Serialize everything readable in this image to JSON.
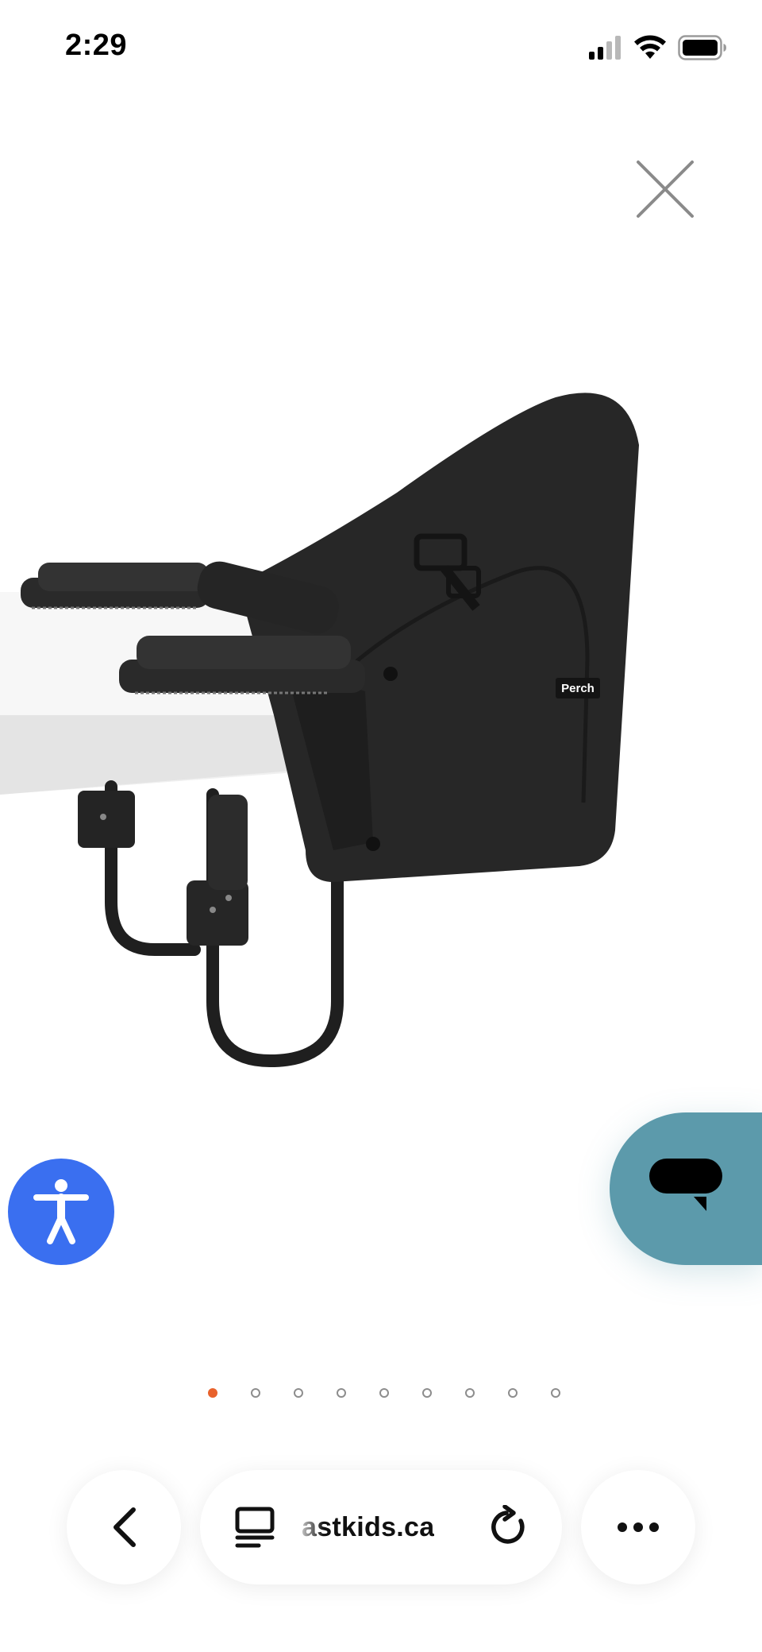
{
  "status_bar": {
    "time": "2:29",
    "icons": [
      "cellular-signal-icon",
      "wifi-icon",
      "battery-icon"
    ]
  },
  "viewer": {
    "close_icon": "close-icon",
    "image_subject": "perch-hook-on-chair",
    "product_label_text": "Perch",
    "pagination": {
      "total": 9,
      "active_index": 0,
      "active_color": "#e8622c"
    }
  },
  "floating": {
    "accessibility_icon": "accessibility-icon",
    "accessibility_color": "#3a6ff0",
    "chat_icon": "chat-bubble-icon",
    "chat_color": "#5c9aab"
  },
  "browser_toolbar": {
    "back_icon": "chevron-left-icon",
    "tabs_icon": "reader-tab-icon",
    "address_text": "astkids.ca",
    "reload_icon": "reload-icon",
    "more_icon": "more-dots-icon"
  }
}
